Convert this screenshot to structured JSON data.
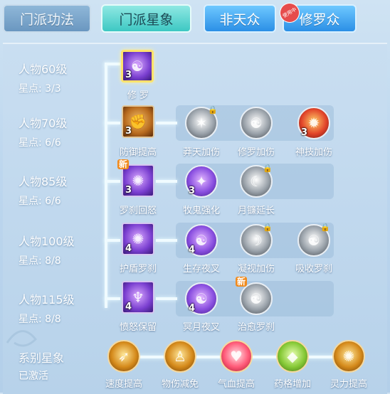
{
  "tabs": [
    {
      "label": "门派功法"
    },
    {
      "label": "门派星象"
    },
    {
      "label": "非天众"
    },
    {
      "label": "修罗众",
      "badge": "使用中"
    }
  ],
  "levels": [
    {
      "title": "人物60级",
      "points": "星点: 3/3"
    },
    {
      "title": "人物70级",
      "points": "星点: 6/6"
    },
    {
      "title": "人物85级",
      "points": "星点: 6/6"
    },
    {
      "title": "人物100级",
      "points": "星点: 8/8"
    },
    {
      "title": "人物115级",
      "points": "星点: 8/8"
    }
  ],
  "rows": [
    {
      "main": {
        "label": "修 罗",
        "count": "3"
      },
      "skills": []
    },
    {
      "main": {
        "label": "防御提高",
        "count": "3"
      },
      "skills": [
        {
          "label": "莽天加伤",
          "count": ""
        },
        {
          "label": "修罗加伤",
          "count": ""
        },
        {
          "label": "神技加伤",
          "count": "3"
        }
      ]
    },
    {
      "main": {
        "label": "罗刹回怒",
        "count": "3",
        "new": "新"
      },
      "skills": [
        {
          "label": "牧鬼强化",
          "count": "3"
        },
        {
          "label": "月镰延长",
          "count": ""
        }
      ]
    },
    {
      "main": {
        "label": "护盾罗刹",
        "count": "4"
      },
      "skills": [
        {
          "label": "生存夜叉",
          "count": "4"
        },
        {
          "label": "凝视加伤",
          "count": ""
        },
        {
          "label": "吸收罗刹",
          "count": ""
        }
      ]
    },
    {
      "main": {
        "label": "愤怒保留",
        "count": "4"
      },
      "skills": [
        {
          "label": "冥月夜叉",
          "count": "4"
        },
        {
          "label": "治愈罗刹",
          "count": "",
          "new": "新"
        }
      ]
    }
  ],
  "system": {
    "title": "系别星象",
    "status": "已激活",
    "items": [
      {
        "label": "速度提高"
      },
      {
        "label": "物伤减免"
      },
      {
        "label": "气血提高"
      },
      {
        "label": "药格增加"
      },
      {
        "label": "灵力提高"
      }
    ]
  },
  "colors": {
    "accent_tab": "#3dc8c3",
    "blue_tab": "#2b8fe6",
    "badge": "#e64c4c",
    "lock": "#e8b83a"
  }
}
